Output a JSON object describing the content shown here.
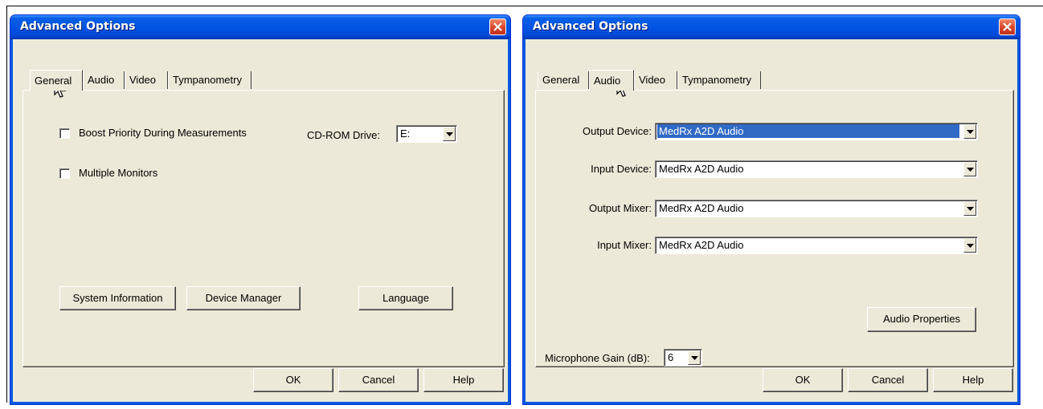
{
  "left_dialog": {
    "title": "Advanced Options",
    "tabs": [
      "General",
      "Audio",
      "Video",
      "Tympanometry"
    ],
    "active_tab": "General",
    "boost_priority_label": "Boost Priority During Measurements",
    "multiple_monitors_label": "Multiple Monitors",
    "cdrom_label": "CD-ROM Drive:",
    "cdrom_value": "E:",
    "system_info_label": "System Information",
    "device_manager_label": "Device Manager",
    "language_label": "Language",
    "ok_label": "OK",
    "cancel_label": "Cancel",
    "help_label": "Help"
  },
  "right_dialog": {
    "title": "Advanced Options",
    "tabs": [
      "General",
      "Audio",
      "Video",
      "Tympanometry"
    ],
    "active_tab": "Audio",
    "output_device_label": "Output Device:",
    "output_device_value": "MedRx A2D Audio",
    "input_device_label": "Input Device:",
    "input_device_value": "MedRx A2D Audio",
    "output_mixer_label": "Output Mixer:",
    "output_mixer_value": "MedRx A2D Audio",
    "input_mixer_label": "Input Mixer:",
    "input_mixer_value": "MedRx A2D Audio",
    "audio_properties_label": "Audio Properties",
    "mic_gain_label": "Microphone Gain (dB):",
    "mic_gain_value": "6",
    "ok_label": "OK",
    "cancel_label": "Cancel",
    "help_label": "Help"
  },
  "icons": [
    "close-icon",
    "dropdown-arrow-icon",
    "mouse-cursor-icon"
  ],
  "colors": {
    "title_bar": "#0054e3",
    "dialog_bg": "#ece9d8",
    "selection": "#316ac5",
    "close_button": "#d8442a"
  }
}
